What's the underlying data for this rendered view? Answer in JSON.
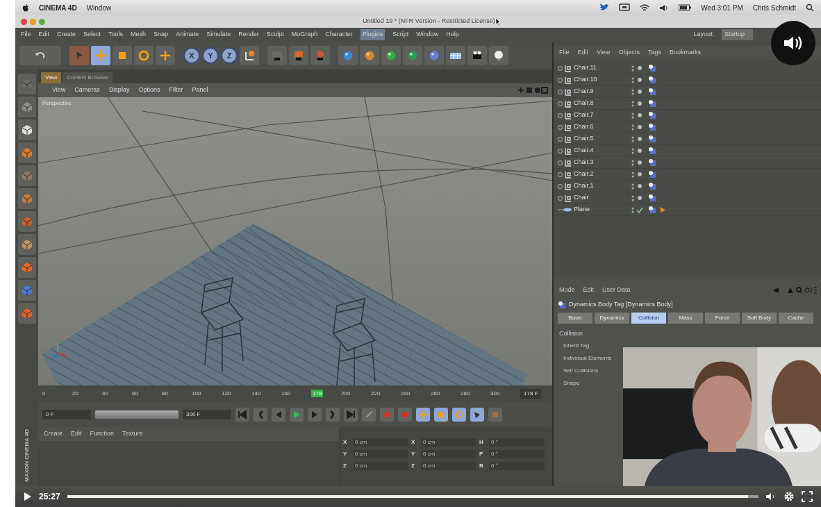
{
  "mac_menubar": {
    "app": "CINEMA 4D",
    "menus": [
      "Window"
    ],
    "clock": "Wed 3:01 PM",
    "user": "Chris Schmidt"
  },
  "window": {
    "title": "Untitled 19 * (NFR Version - Restricted License)"
  },
  "menu": [
    {
      "label": "File",
      "selected": false
    },
    {
      "label": "Edit",
      "selected": false
    },
    {
      "label": "Create",
      "selected": false
    },
    {
      "label": "Select",
      "selected": false
    },
    {
      "label": "Tools",
      "selected": false
    },
    {
      "label": "Mesh",
      "selected": false
    },
    {
      "label": "Snap",
      "selected": false
    },
    {
      "label": "Animate",
      "selected": false
    },
    {
      "label": "Simulate",
      "selected": false
    },
    {
      "label": "Render",
      "selected": false
    },
    {
      "label": "Sculpt",
      "selected": false
    },
    {
      "label": "MoGraph",
      "selected": false
    },
    {
      "label": "Character",
      "selected": false
    },
    {
      "label": "Plugins",
      "selected": true
    },
    {
      "label": "Script",
      "selected": false
    },
    {
      "label": "Window",
      "selected": false
    },
    {
      "label": "Help",
      "selected": false
    }
  ],
  "layout": {
    "label": "Layout:",
    "value": "Startup"
  },
  "axis_buttons": [
    {
      "label": "X",
      "on": true
    },
    {
      "label": "Y",
      "on": true
    },
    {
      "label": "Z",
      "on": true
    }
  ],
  "viewport": {
    "tabs": [
      {
        "label": "View",
        "selected": true
      },
      {
        "label": "Content Browser",
        "selected": false
      }
    ],
    "menu": [
      "View",
      "Cameras",
      "Display",
      "Options",
      "Filter",
      "Panel"
    ],
    "label": "Perspective"
  },
  "timeline": {
    "ticks": [
      {
        "label": "0",
        "current": false
      },
      {
        "label": "20",
        "current": false
      },
      {
        "label": "40",
        "current": false
      },
      {
        "label": "60",
        "current": false
      },
      {
        "label": "80",
        "current": false
      },
      {
        "label": "100",
        "current": false
      },
      {
        "label": "120",
        "current": false
      },
      {
        "label": "140",
        "current": false
      },
      {
        "label": "160",
        "current": false
      },
      {
        "label": "178",
        "current": true
      },
      {
        "label": "200",
        "current": false
      },
      {
        "label": "220",
        "current": false
      },
      {
        "label": "240",
        "current": false
      },
      {
        "label": "260",
        "current": false
      },
      {
        "label": "280",
        "current": false
      },
      {
        "label": "300",
        "current": false
      }
    ],
    "frame": "178 F"
  },
  "transport": {
    "start": "0 F",
    "end": "300 F",
    "range": {
      "level": 1
    }
  },
  "materials": {
    "menu": [
      "Create",
      "Edit",
      "Function",
      "Texture"
    ]
  },
  "coordinates": {
    "rows": [
      {
        "axis": "X",
        "position": "0 cm",
        "size_axis": "X",
        "size": "0 cm",
        "rot_axis": "H",
        "rotation": "0 °"
      },
      {
        "axis": "Y",
        "position": "0 cm",
        "size_axis": "Y",
        "size": "0 cm",
        "rot_axis": "P",
        "rotation": "0 °"
      },
      {
        "axis": "Z",
        "position": "0 cm",
        "size_axis": "Z",
        "size": "0 cm",
        "rot_axis": "B",
        "rotation": "0 °"
      }
    ]
  },
  "side_label": "MAXON CINEMA 4D",
  "objects": {
    "menu": [
      "File",
      "Edit",
      "View",
      "Objects",
      "Tags",
      "Bookmarks"
    ],
    "items": [
      {
        "name": "Chair.11",
        "kind": "null"
      },
      {
        "name": "Chair.10",
        "kind": "null"
      },
      {
        "name": "Chair.9",
        "kind": "null"
      },
      {
        "name": "Chair.8",
        "kind": "null"
      },
      {
        "name": "Chair.7",
        "kind": "null"
      },
      {
        "name": "Chair.6",
        "kind": "null"
      },
      {
        "name": "Chair.5",
        "kind": "null"
      },
      {
        "name": "Chair.4",
        "kind": "null"
      },
      {
        "name": "Chair.3",
        "kind": "null"
      },
      {
        "name": "Chair.2",
        "kind": "null"
      },
      {
        "name": "Chair.1",
        "kind": "null"
      },
      {
        "name": "Chair",
        "kind": "null"
      },
      {
        "name": "Plane",
        "kind": "plane"
      }
    ]
  },
  "attributes": {
    "menu": [
      "Mode",
      "Edit",
      "User Data"
    ],
    "title": "Dynamics Body Tag [Dynamics Body]",
    "tabs": [
      {
        "label": "Basic",
        "selected": false
      },
      {
        "label": "Dynamics",
        "selected": false
      },
      {
        "label": "Collision",
        "selected": true
      },
      {
        "label": "Mass",
        "selected": false
      },
      {
        "label": "Force",
        "selected": false
      },
      {
        "label": "Soft Body",
        "selected": false
      },
      {
        "label": "Cache",
        "selected": false
      }
    ],
    "section": "Collision",
    "rows": [
      "Inherit Tag",
      "Individual Elements",
      "Self Collisions",
      "Shape"
    ]
  },
  "player": {
    "time": "25:27",
    "level": 0.985
  }
}
